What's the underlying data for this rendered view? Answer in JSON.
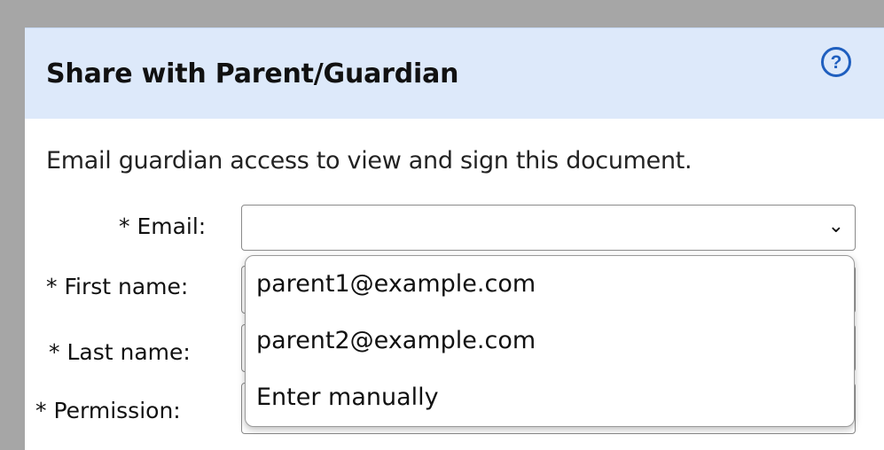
{
  "dialog": {
    "title": "Share with Parent/Guardian",
    "help_icon": "question-circle-icon",
    "help_glyph": "?",
    "description": "Email guardian access to view and sign this document."
  },
  "form": {
    "email_label": "* Email:",
    "email_value": "",
    "first_name_label": "* First name:",
    "last_name_label": "* Last name:",
    "permission_label": "* Permission:",
    "chevron_glyph": "⌄"
  },
  "email_dropdown": {
    "options": [
      "parent1@example.com",
      "parent2@example.com",
      "Enter manually"
    ]
  },
  "colors": {
    "header_bg": "#dde9fa",
    "accent": "#1f5fbf",
    "backdrop": "#a6a6a6"
  }
}
